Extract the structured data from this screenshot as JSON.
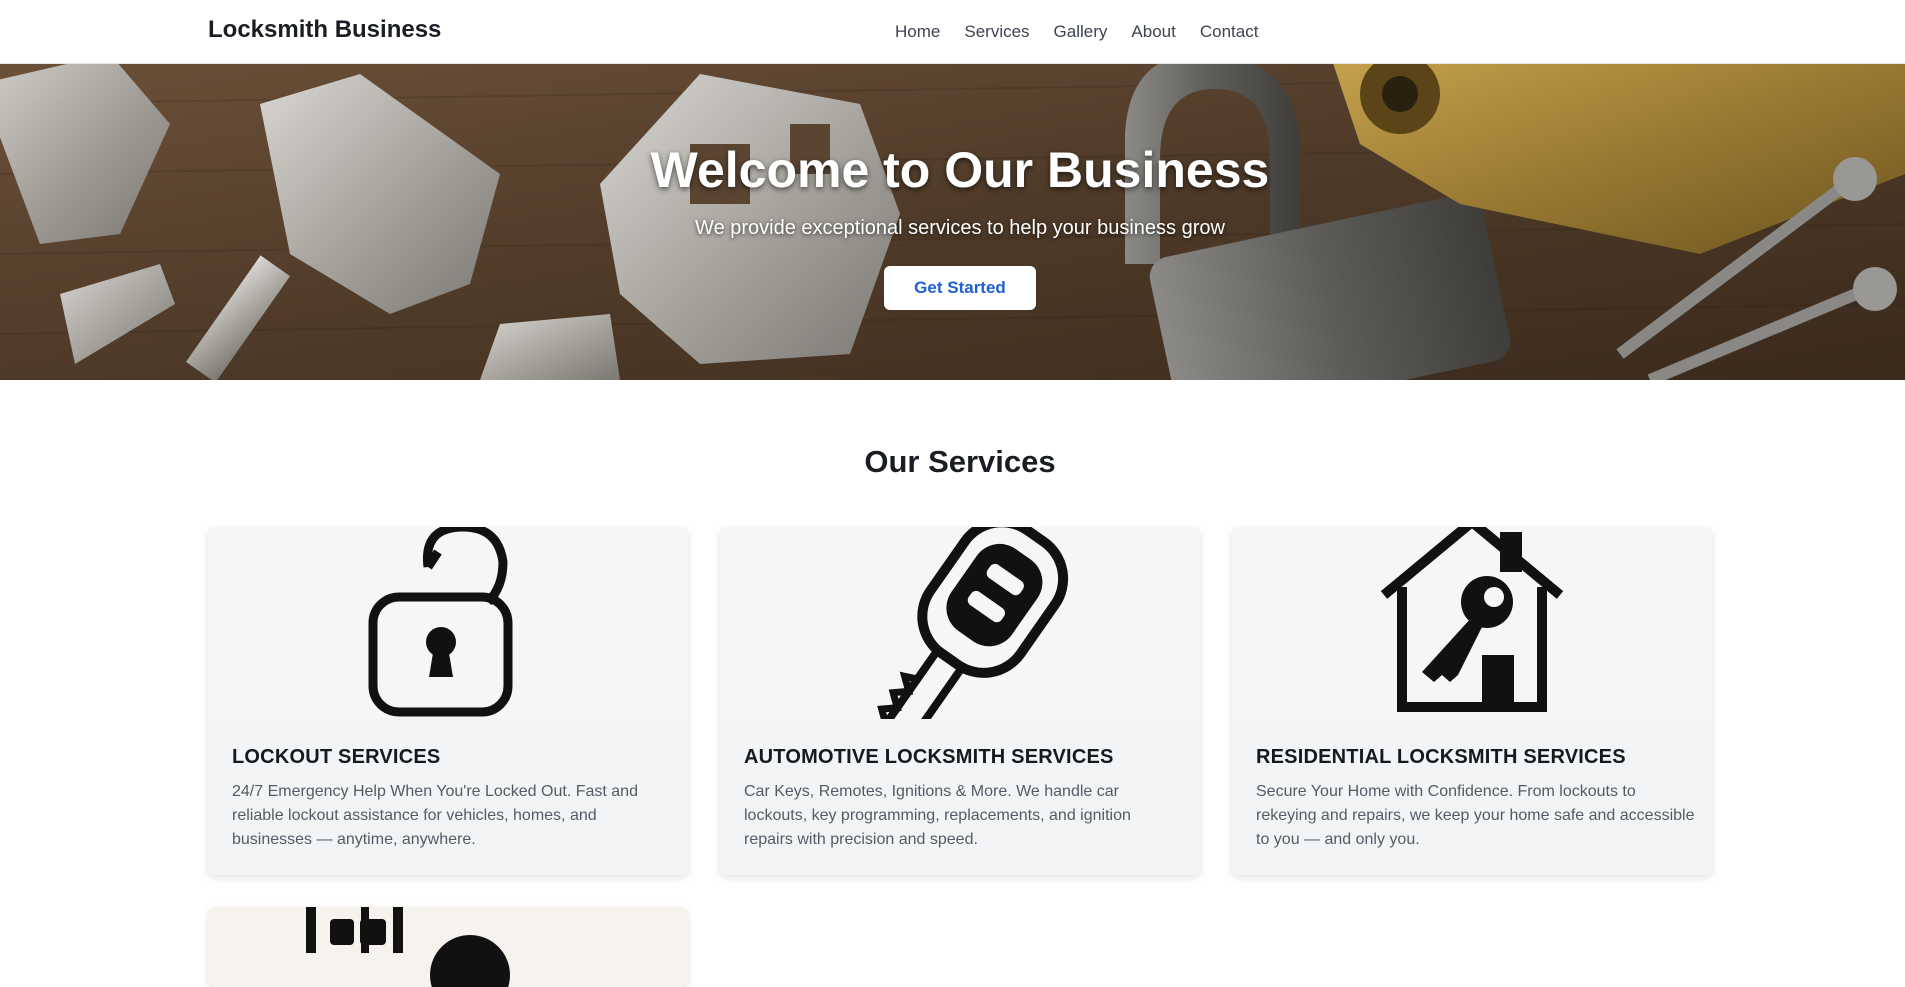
{
  "header": {
    "brand": "Locksmith Business",
    "nav": [
      "Home",
      "Services",
      "Gallery",
      "About",
      "Contact"
    ]
  },
  "hero": {
    "title": "Welcome to Our Business",
    "subtitle": "We provide exceptional services to help your business grow",
    "cta": "Get Started"
  },
  "services": {
    "title": "Our Services",
    "items": [
      {
        "icon": "unlocked-padlock-icon",
        "title": "LOCKOUT SERVICES",
        "desc": "24/7 Emergency Help When You're Locked Out. Fast and reliable lockout assistance for vehicles, homes, and businesses — anytime, anywhere."
      },
      {
        "icon": "car-key-icon",
        "title": "AUTOMOTIVE LOCKSMITH SERVICES",
        "desc": "Car Keys, Remotes, Ignitions & More. We handle car lockouts, key programming, replacements, and ignition repairs with precision and speed."
      },
      {
        "icon": "house-key-icon",
        "title": "RESIDENTIAL LOCKSMITH SERVICES",
        "desc": "Secure Your Home with Confidence. From lockouts to rekeying and repairs, we keep your home safe and accessible to you — and only you."
      },
      {
        "icon": "commercial-building-lock-icon"
      }
    ]
  },
  "colors": {
    "accent": "#1d5fd6",
    "text_dark": "#1a1d24",
    "text_muted": "#545b67",
    "card_bg": "#f3f4f6"
  }
}
